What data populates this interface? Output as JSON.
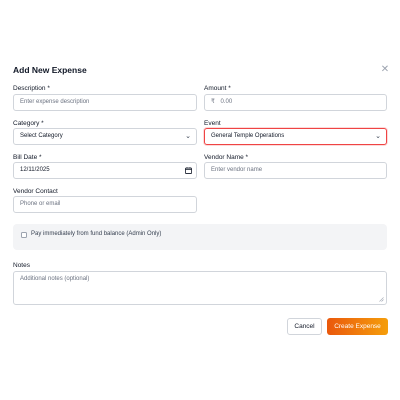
{
  "dialog": {
    "title": "Add New Expense",
    "close_icon": "close-icon"
  },
  "form": {
    "description": {
      "label": "Description *",
      "placeholder": "Enter expense description"
    },
    "amount": {
      "label": "Amount *",
      "prefix": "₹",
      "placeholder": "0.00"
    },
    "category": {
      "label": "Category *",
      "value": "Select Category"
    },
    "event": {
      "label": "Event",
      "value": "General Temple Operations"
    },
    "bill_date": {
      "label": "Bill Date *",
      "value": "12/11/2025"
    },
    "vendor_name": {
      "label": "Vendor Name *",
      "placeholder": "Enter vendor name"
    },
    "vendor_contact": {
      "label": "Vendor Contact",
      "placeholder": "Phone or email"
    },
    "pay_from_fund": {
      "label": "Pay immediately from fund balance (Admin Only)",
      "checked": false
    },
    "notes": {
      "label": "Notes",
      "placeholder": "Additional notes (optional)"
    }
  },
  "actions": {
    "cancel_label": "Cancel",
    "create_label": "Create Expense"
  },
  "colors": {
    "accent_start": "#ea580c",
    "accent_end": "#f59e0b",
    "event_border": "#ef4444"
  }
}
